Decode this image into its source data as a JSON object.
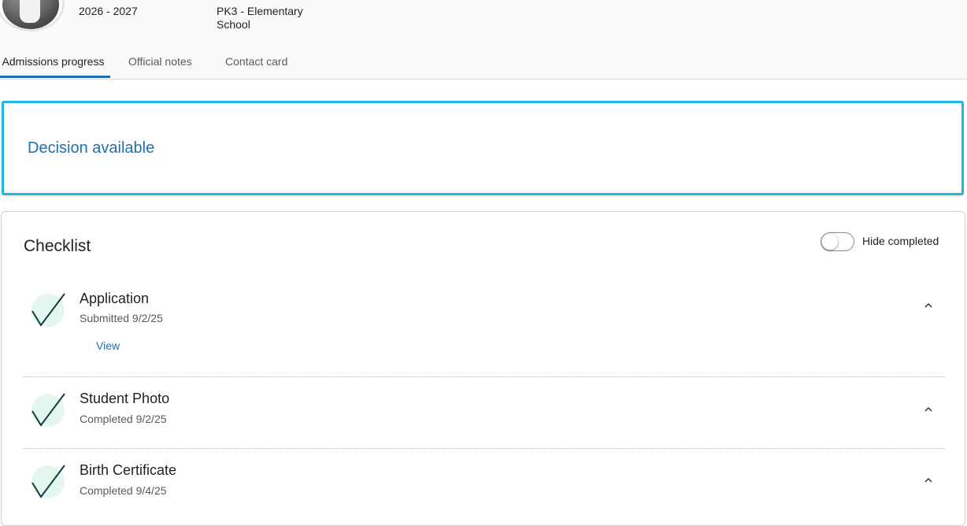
{
  "header": {
    "school_year": "2026 - 2027",
    "grade_range": "PK3 - Elementary School"
  },
  "tabs": [
    {
      "label": "Admissions progress",
      "active": true
    },
    {
      "label": "Official notes",
      "active": false
    },
    {
      "label": "Contact card",
      "active": false
    }
  ],
  "decision": {
    "label": "Decision available",
    "border_color": "#1eb4e3",
    "text_color": "#1d6fb0"
  },
  "checklist": {
    "title": "Checklist",
    "toggle_label": "Hide completed",
    "toggle_on": false,
    "items": [
      {
        "title": "Application",
        "status": "Submitted 9/2/25",
        "link": "View",
        "icon": "checkmark-icon"
      },
      {
        "title": "Student Photo",
        "status": "Completed 9/2/25",
        "icon": "checkmark-icon"
      },
      {
        "title": "Birth Certificate",
        "status": "Completed 9/4/25",
        "icon": "checkmark-icon"
      }
    ]
  },
  "colors": {
    "accent": "#1d6fb0",
    "check_stroke": "#0d3b46",
    "check_fill": "#e3f7ee"
  }
}
